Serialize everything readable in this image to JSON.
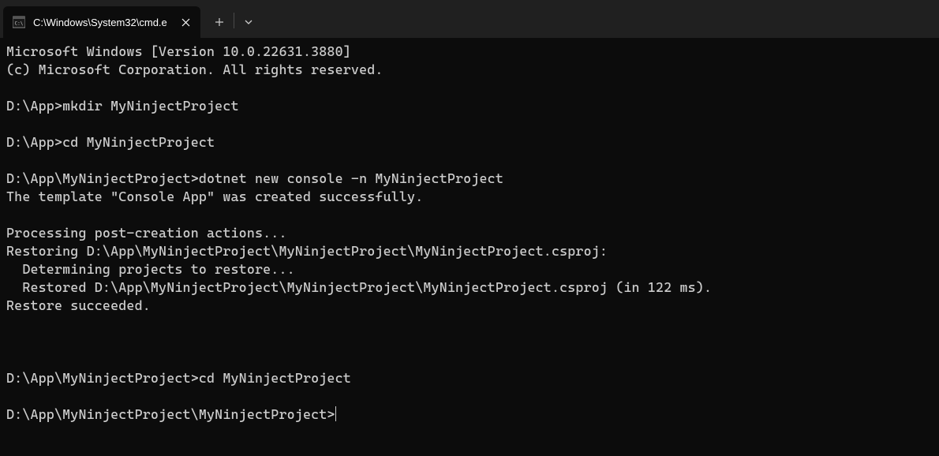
{
  "tab": {
    "title": "C:\\Windows\\System32\\cmd.e"
  },
  "terminal": {
    "lines": [
      "Microsoft Windows [Version 10.0.22631.3880]",
      "(c) Microsoft Corporation. All rights reserved.",
      "",
      "D:\\App>mkdir MyNinjectProject",
      "",
      "D:\\App>cd MyNinjectProject",
      "",
      "D:\\App\\MyNinjectProject>dotnet new console -n MyNinjectProject",
      "The template \"Console App\" was created successfully.",
      "",
      "Processing post-creation actions...",
      "Restoring D:\\App\\MyNinjectProject\\MyNinjectProject\\MyNinjectProject.csproj:",
      "  Determining projects to restore...",
      "  Restored D:\\App\\MyNinjectProject\\MyNinjectProject\\MyNinjectProject.csproj (in 122 ms).",
      "Restore succeeded.",
      "",
      "",
      "",
      "D:\\App\\MyNinjectProject>cd MyNinjectProject",
      "",
      "D:\\App\\MyNinjectProject\\MyNinjectProject>"
    ]
  }
}
